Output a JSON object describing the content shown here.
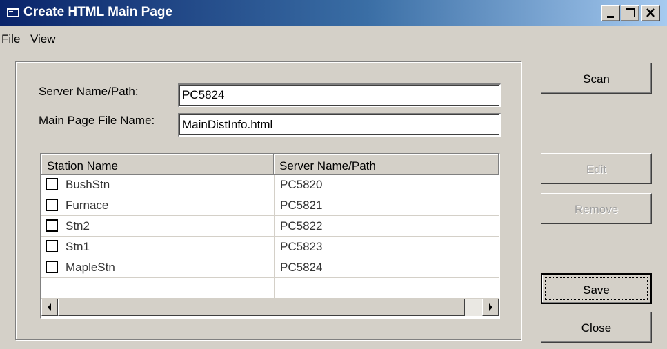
{
  "window": {
    "title": "Create HTML Main Page",
    "controls": [
      "minimize-icon",
      "maximize-icon",
      "close-icon"
    ]
  },
  "menu": {
    "items": [
      "File",
      "View"
    ]
  },
  "form": {
    "server_label": "Server Name/Path:",
    "server_value": "PC5824",
    "file_label": "Main Page File Name:",
    "file_value": "MainDistInfo.html"
  },
  "list": {
    "columns": [
      "Station Name",
      "Server Name/Path"
    ],
    "rows": [
      {
        "station": "BushStn",
        "server": "PC5820",
        "checked": false
      },
      {
        "station": "Furnace",
        "server": "PC5821",
        "checked": false
      },
      {
        "station": "Stn2",
        "server": "PC5822",
        "checked": false
      },
      {
        "station": "Stn1",
        "server": "PC5823",
        "checked": false
      },
      {
        "station": "MapleStn",
        "server": "PC5824",
        "checked": false
      }
    ]
  },
  "buttons": {
    "scan": "Scan",
    "edit": "Edit",
    "remove": "Remove",
    "save": "Save",
    "close": "Close"
  },
  "colors": {
    "title_start": "#0a246a",
    "title_end": "#a6caf0",
    "face": "#d4d0c8"
  }
}
